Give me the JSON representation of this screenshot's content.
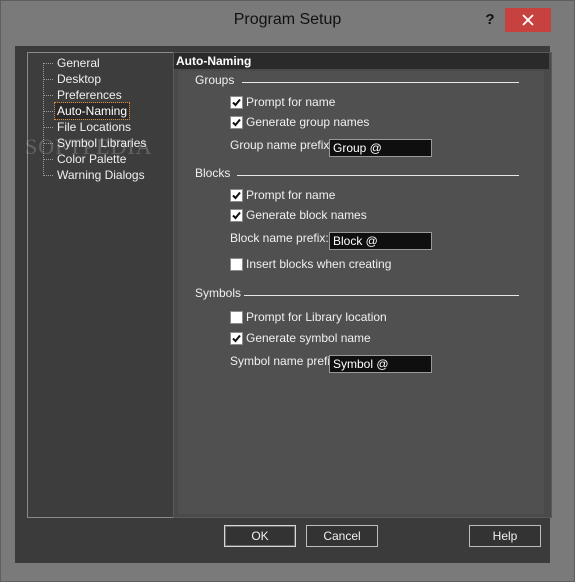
{
  "window": {
    "title": "Program Setup",
    "help_glyph": "?",
    "close_icon": "close-icon"
  },
  "tree": {
    "items": [
      {
        "label": "General"
      },
      {
        "label": "Desktop"
      },
      {
        "label": "Preferences"
      },
      {
        "label": "Auto-Naming",
        "selected": true
      },
      {
        "label": "File Locations"
      },
      {
        "label": "Symbol Libraries"
      },
      {
        "label": "Color Palette"
      },
      {
        "label": "Warning Dialogs"
      }
    ]
  },
  "panel": {
    "header": "Auto-Naming",
    "groups": {
      "title": "Groups",
      "prompt_label": "Prompt for name",
      "prompt_checked": true,
      "generate_label": "Generate group names",
      "generate_checked": true,
      "prefix_label": "Group name prefix:",
      "prefix_value": "Group @"
    },
    "blocks": {
      "title": "Blocks",
      "prompt_label": "Prompt for name",
      "prompt_checked": true,
      "generate_label": "Generate block names",
      "generate_checked": true,
      "prefix_label": "Block name prefix:",
      "prefix_value": "Block @",
      "insert_label": "Insert blocks when creating",
      "insert_checked": false
    },
    "symbols": {
      "title": "Symbols",
      "prompt_label": "Prompt for Library location",
      "prompt_checked": false,
      "generate_label": "Generate symbol name",
      "generate_checked": true,
      "prefix_label": "Symbol name prefix:",
      "prefix_value": "Symbol @"
    }
  },
  "buttons": {
    "ok": "OK",
    "cancel": "Cancel",
    "help": "Help"
  },
  "watermark": "SOFTPEDIA"
}
